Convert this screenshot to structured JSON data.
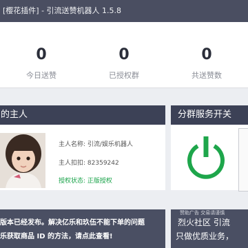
{
  "titlebar": {
    "text": "[樱花插件] - 引流送赞机器人 1.5.8"
  },
  "stats": [
    {
      "value": "0",
      "label": "今日送赞"
    },
    {
      "value": "0",
      "label": "已授权群"
    },
    {
      "value": "0",
      "label": "共送赞数"
    }
  ],
  "owner": {
    "header": "的主人",
    "name_label": "主人名称:",
    "name_value": "引流/娱乐机器人",
    "qq_label": "主人扣扣:",
    "qq_value": "82359242",
    "status_label": "授权状态:",
    "status_value": "正版授权"
  },
  "switch": {
    "header": "分群服务开关"
  },
  "notice": {
    "line1": "版本已经发布。解决亿乐和玖伍不能下单的问题",
    "line2": "乐获取商品 ID 的方法，请点此查看!"
  },
  "ad": {
    "tag": "赞助广告 交易请谨慎",
    "title": "烈火社区 引流",
    "subtitle": "只做优质业务，"
  },
  "colors": {
    "accent_green": "#1aa34a",
    "header_dark": "#3c4156",
    "banner": "#4a4f63"
  }
}
